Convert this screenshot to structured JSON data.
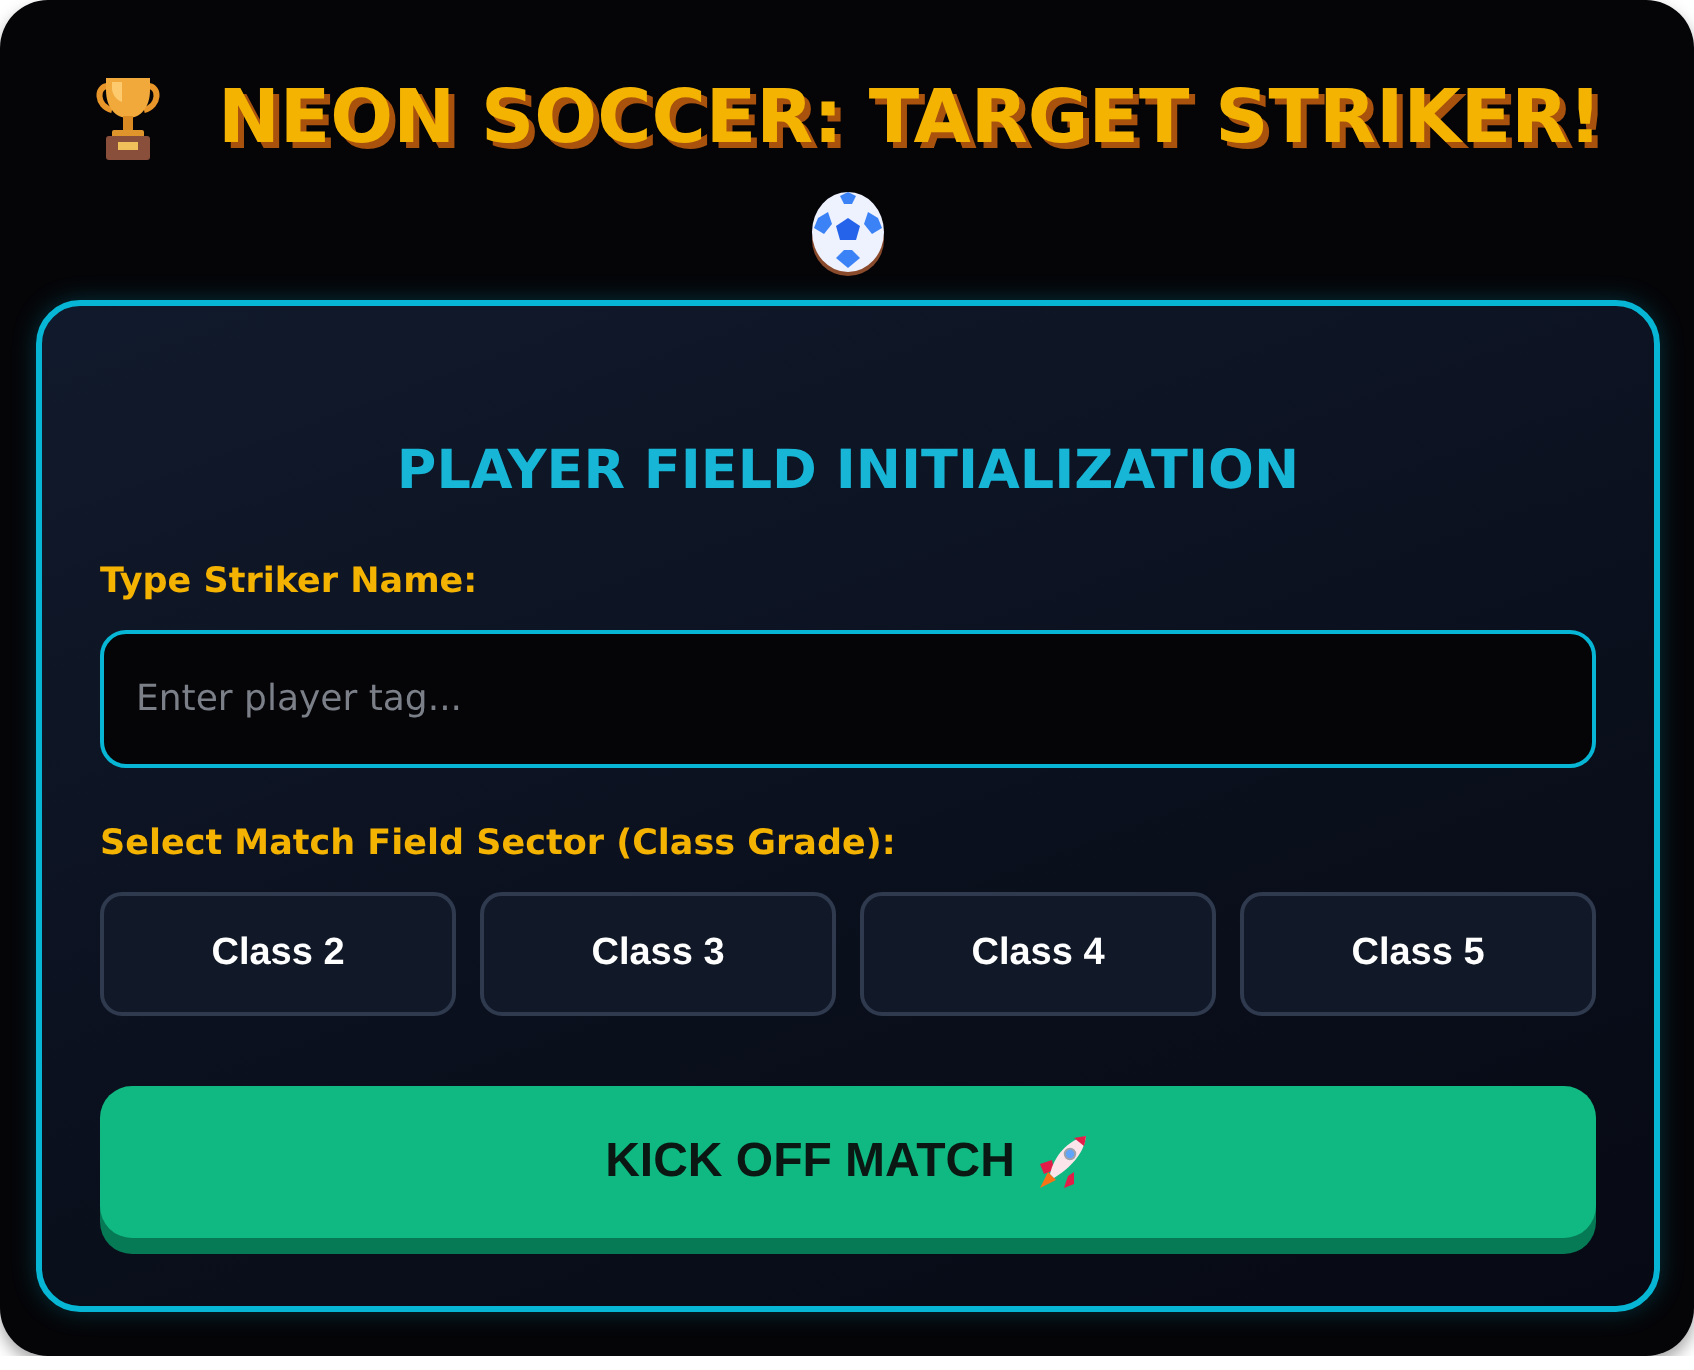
{
  "title": {
    "text": "NEON SOCCER: TARGET STRIKER!"
  },
  "panel": {
    "heading": "PLAYER FIELD INITIALIZATION",
    "name_label": "Type Striker Name:",
    "name_field": {
      "placeholder": "Enter player tag..."
    },
    "sector_label": "Select Match Field Sector (Class Grade):",
    "classes": [
      {
        "label": "Class 2",
        "selected": false
      },
      {
        "label": "Class 3",
        "selected": false
      },
      {
        "label": "Class 4",
        "selected": false
      },
      {
        "label": "Class 5",
        "selected": false
      }
    ],
    "start_button": {
      "label": "KICK OFF MATCH"
    }
  }
}
